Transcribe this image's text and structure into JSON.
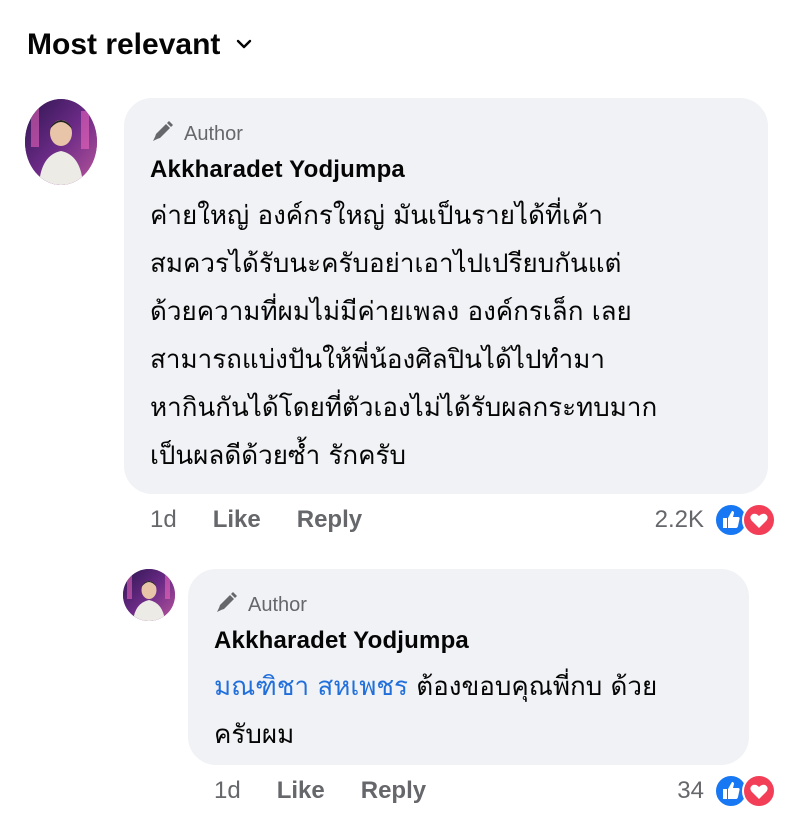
{
  "sort": {
    "label": "Most relevant"
  },
  "comments": [
    {
      "author_badge": "Author",
      "name": "Akkharadet Yodjumpa",
      "text": "ค่ายใหญ่ องค์กรใหญ่ มันเป็นรายได้ที่เค้า\nสมควรได้รับนะครับอย่าเอาไปเปรียบกันแต่\nด้วยความที่ผมไม่มีค่ายเพลง องค์กรเล็ก เลย\nสามารถแบ่งปันให้พี่น้องศิลปินได้ไปทำมา\nหากินกันได้โดยที่ตัวเองไม่ได้รับผลกระทบมาก\nเป็นผลดีด้วยซ้ำ รักครับ",
      "time": "1d",
      "like": "Like",
      "reply": "Reply",
      "reaction_count": "2.2K"
    },
    {
      "author_badge": "Author",
      "name": "Akkharadet Yodjumpa",
      "mention": "มณฑิชา สหเพชร",
      "text": " ต้องขอบคุณพี่กบ ด้วย\nครับผม",
      "time": "1d",
      "like": "Like",
      "reply": "Reply",
      "reaction_count": "34"
    }
  ],
  "colors": {
    "bubble": "#f0f2f5",
    "like_blue": "#1877f2",
    "love_red": "#f33e58",
    "mention": "#216fdb",
    "meta_gray": "#65676b"
  },
  "icons": [
    "chevron-down-icon",
    "author-pen-icon",
    "like-reaction-icon",
    "love-reaction-icon"
  ]
}
